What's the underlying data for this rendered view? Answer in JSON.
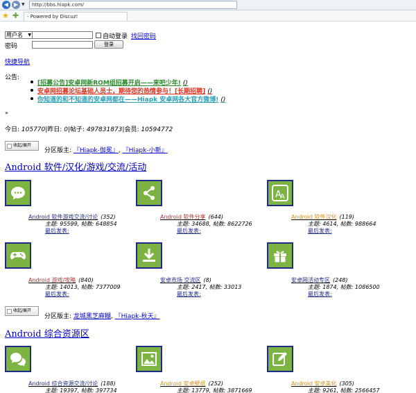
{
  "browser": {
    "address": "http://bbs.hiapk.com/",
    "tab_title": "- Powered by Discuz!"
  },
  "login": {
    "user_select": "用户名",
    "auto_login": "自动登录",
    "find_password": "找回密码",
    "password_label": "密码",
    "login_button": "登录"
  },
  "quick_nav": "快捷导航",
  "announcement": {
    "label": "公告:",
    "items": [
      {
        "text": "[招募公告]安卓网新ROM组招募开启——来吧少年!",
        "paren": "()"
      },
      {
        "text": "安卓网招募论坛基础人员士，期待您的热情参与！[长期招聘]",
        "paren": "()"
      },
      {
        "text": "你知道的和不知道的安卓网都在——Hiapk 安卓网各大官方微博!",
        "paren": "()"
      }
    ]
  },
  "misc_glyph": "»",
  "stats": {
    "today_label": "今日: ",
    "today": "105770",
    "yesterday_label": "|昨日: ",
    "yesterday": "0",
    "posts_label": "|帖子: ",
    "posts": "497831873",
    "members_label": "|会员: ",
    "members": "10594772"
  },
  "toggle_label": "收起/展开",
  "sections": [
    {
      "moderator_label": "分区版主: ",
      "moderators": [
        "『Hiapk-伽冕』",
        "『Hiapk-小新』"
      ],
      "title": "Android 软件/汉化/游戏/交流/活动",
      "forums": [
        {
          "icon": "chat-bubble-icon",
          "name": "Android 软件游戏交流/讨论",
          "count": "(352)",
          "stats": "主题: 95599, 帖数: 648854",
          "last": "最后发表:",
          "color": "blue"
        },
        {
          "icon": "share-icon",
          "name": "Android 软件分享",
          "count": "(644)",
          "stats": "主题: 34688, 帖数: 8622726",
          "last": "最后发表:",
          "color": "red"
        },
        {
          "icon": "font-translate-icon",
          "name": "Android 软件汉化",
          "count": "(119)",
          "stats": "主题: 4614, 帖数: 988664",
          "last": "最后发表:",
          "color": "orange"
        },
        {
          "icon": "gamepad-icon",
          "name": "Android 游戏/攻略",
          "count": "(840)",
          "stats": "主题: 14013, 帖数: 7377009",
          "last": "最后发表:",
          "color": "red"
        },
        {
          "icon": "download-icon",
          "name": "安卓市场 交流区",
          "count": "(8)",
          "stats": "主题: 2417, 帖数: 33013",
          "last": "最后发表:",
          "color": "blue"
        },
        {
          "icon": "gift-icon",
          "name": "安卓网活动专区",
          "count": "(248)",
          "stats": "主题: 1874, 帖数: 1086500",
          "last": "最后发表:",
          "color": "blue"
        }
      ]
    },
    {
      "moderator_label": "分区版主: ",
      "moderators": [
        "龙城黑芝麻糊",
        "『Hiapk-秋天』"
      ],
      "title": "Android 综合资源区",
      "forums": [
        {
          "icon": "chat-bubbles-icon",
          "name": "Android 综合资源交流/讨论",
          "count": "(188)",
          "stats": "主题: 19397, 帖数: 397734",
          "color": "blue"
        },
        {
          "icon": "image-icon",
          "name": "Android 安卓壁纸",
          "count": "(252)",
          "stats": "主题: 13779, 帖数: 3871669",
          "color": "orange"
        },
        {
          "icon": "edit-icon",
          "name": "Android 安卓美化",
          "count": "(305)",
          "stats": "主题: 9261, 帖数: 2566457",
          "color": "orange"
        }
      ]
    }
  ],
  "colors": {
    "icon_green": "#7cb342",
    "icon_border": "#1e2a88",
    "link_blue": "#0000cc"
  }
}
